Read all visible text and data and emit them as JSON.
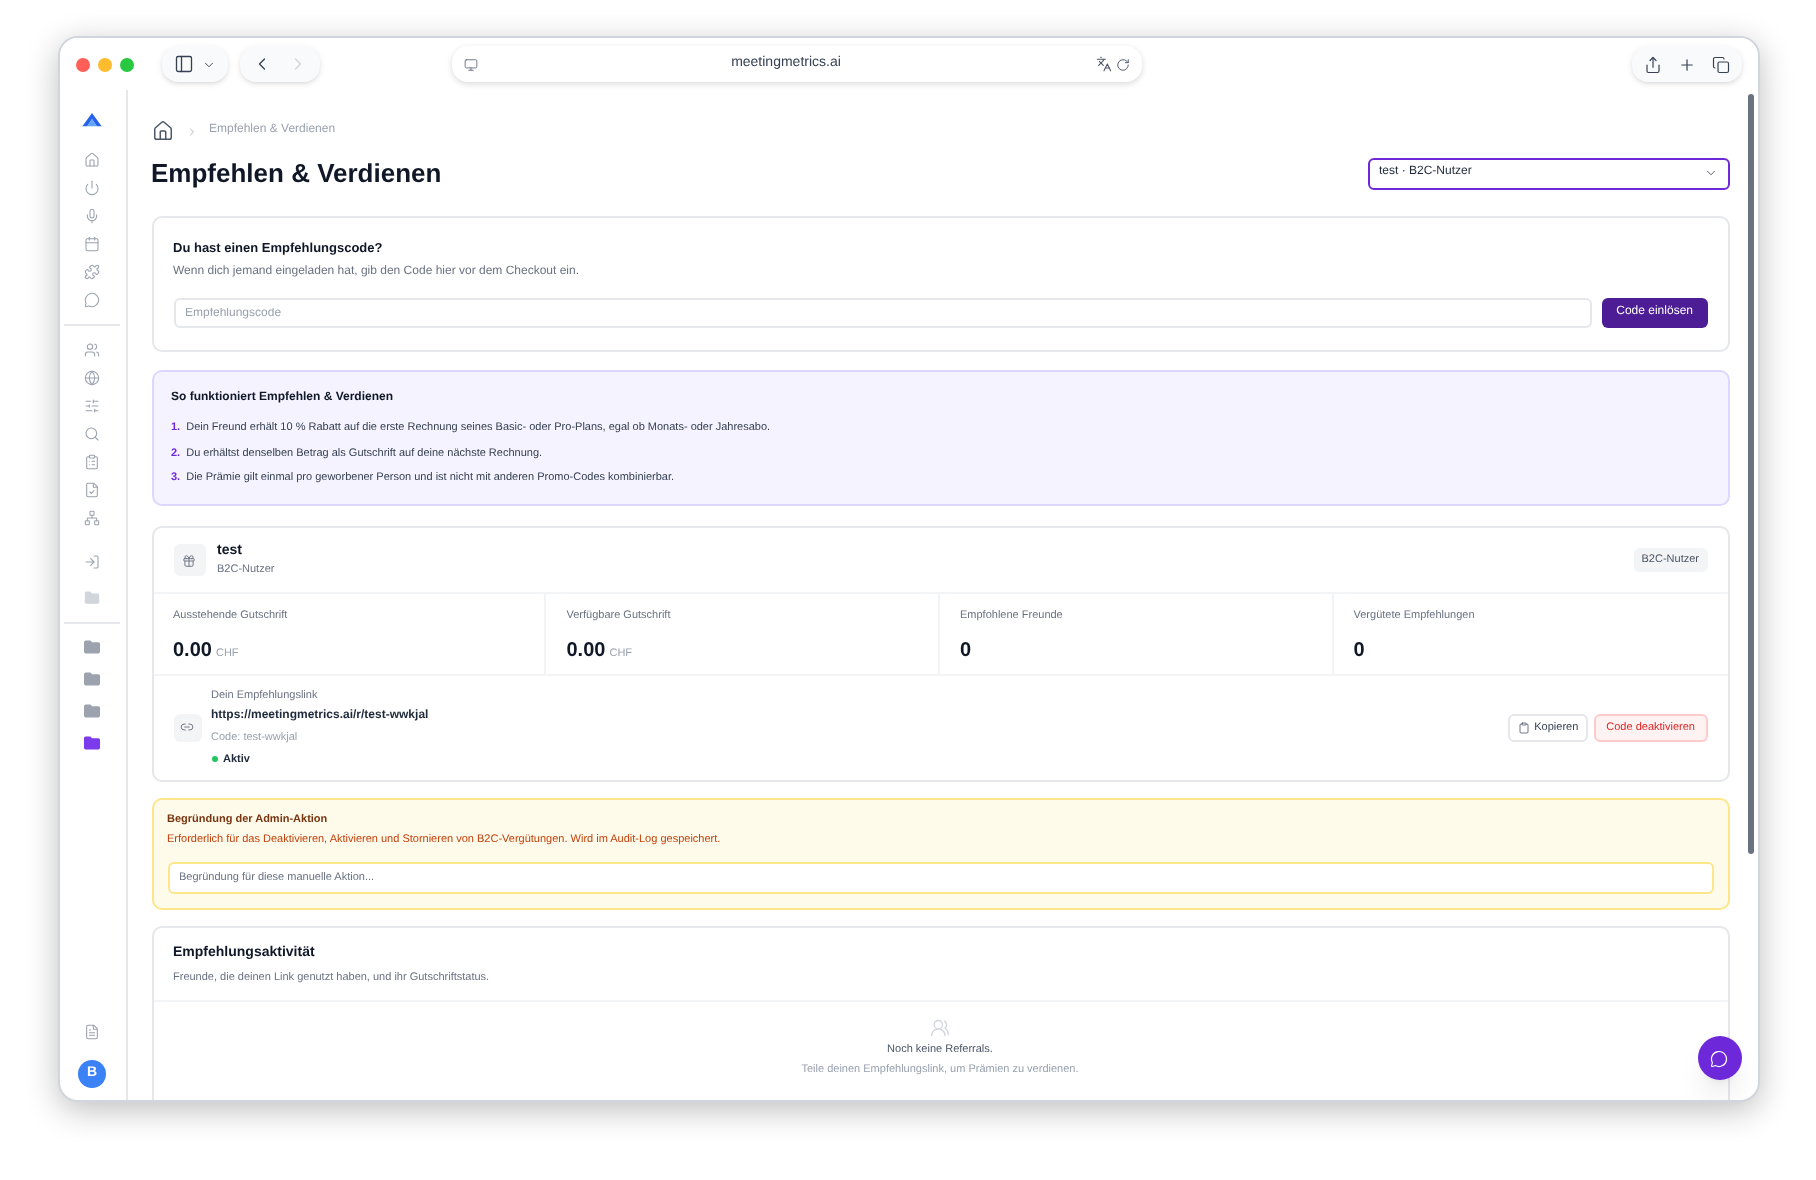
{
  "browser": {
    "url": "meetingmetrics.ai"
  },
  "sidebar": {
    "folders": [
      {
        "color": "#9ca3af"
      },
      {
        "color": "#9ca3af"
      },
      {
        "color": "#9ca3af"
      },
      {
        "color": "#7c3aed"
      }
    ],
    "avatar": "B"
  },
  "breadcrumb": [
    "Empfehlen & Verdienen"
  ],
  "title": "Empfehlen & Verdienen",
  "user_select": {
    "value": "test · B2C-Nutzer"
  },
  "code_card": {
    "title": "Du hast einen Empfehlungscode?",
    "subtitle": "Wenn dich jemand eingeladen hat, gib den Code hier vor dem Checkout ein.",
    "placeholder": "Empfehlungscode",
    "button": "Code einlösen"
  },
  "info_card": {
    "title": "So funktioniert Empfehlen & Verdienen",
    "steps": [
      {
        "number": "1.",
        "text": "Dein Freund erhält 10 % Rabatt auf die erste Rechnung seines Basic- oder Pro-Plans, egal ob Monats- oder Jahresabo."
      },
      {
        "number": "2.",
        "text": "Du erhältst denselben Betrag als Gutschrift auf deine nächste Rechnung."
      },
      {
        "number": "3.",
        "text": "Die Prämie gilt einmal pro geworbener Person und ist nicht mit anderen Promo-Codes kombinierbar."
      }
    ]
  },
  "profile": {
    "name": "test",
    "type": "B2C-Nutzer",
    "badge": "B2C-Nutzer",
    "stats": [
      {
        "label": "Ausstehende Gutschrift",
        "value": "0.00",
        "unit": "CHF"
      },
      {
        "label": "Verfügbare Gutschrift",
        "value": "0.00",
        "unit": "CHF"
      },
      {
        "label": "Empfohlene Freunde",
        "value": "0"
      },
      {
        "label": "Vergütete Empfehlungen",
        "value": "0"
      }
    ],
    "link": {
      "label": "Dein Empfehlungslink",
      "url": "https://meetingmetrics.ai/r/test-wwkjal",
      "code": "Code: test-wwkjal",
      "status": "Aktiv",
      "active": true
    },
    "buttons": {
      "copy": "Kopieren",
      "deactivate": "Code deaktivieren"
    }
  },
  "admin_card": {
    "title": "Begründung der Admin-Aktion",
    "subtitle": "Erforderlich für das Deaktivieren, Aktivieren und Stornieren von B2C-Vergütungen. Wird im Audit-Log gespeichert.",
    "placeholder": "Begründung für diese manuelle Aktion..."
  },
  "activity_card": {
    "title": "Empfehlungsaktivität",
    "subtitle": "Freunde, die deinen Link genutzt haben, und ihr Gutschriftstatus.",
    "empty_title": "Noch keine Referrals.",
    "empty_text": "Teile deinen Empfehlungslink, um Prämien zu verdienen."
  }
}
